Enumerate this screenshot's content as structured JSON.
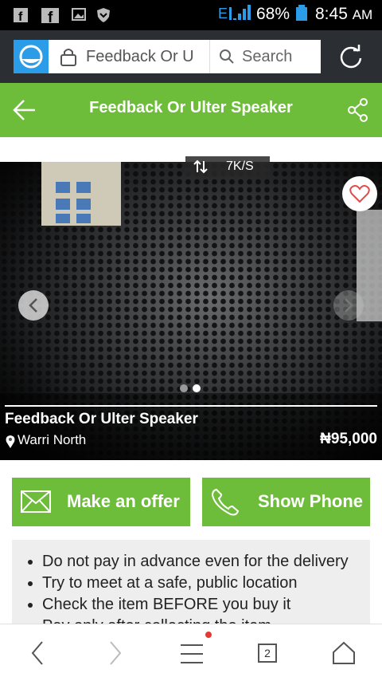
{
  "status_bar": {
    "signal": "E",
    "battery_pct": "68%",
    "time": "8:45",
    "ampm": "AM"
  },
  "browser": {
    "url_text": "Feedback Or U",
    "search_label": "Search"
  },
  "header": {
    "title": "Feedback Or Ulter Speaker"
  },
  "gallery": {
    "speed": "7K/S",
    "item_title": "Feedback Or Ulter Speaker",
    "location": "Warri North",
    "price": "₦95,000"
  },
  "actions": {
    "offer_label": "Make an offer",
    "phone_label": "Show Phone"
  },
  "tips": [
    "Do not pay in advance even for the delivery",
    "Try to meet at a safe, public location",
    "Check the item BEFORE you buy it",
    "Pay only after collecting the item"
  ],
  "nav": {
    "tab_count": "2"
  },
  "colors": {
    "accent": "#6ebd3a",
    "browser_bar": "#2b2e33",
    "logo": "#2a9ce8"
  }
}
